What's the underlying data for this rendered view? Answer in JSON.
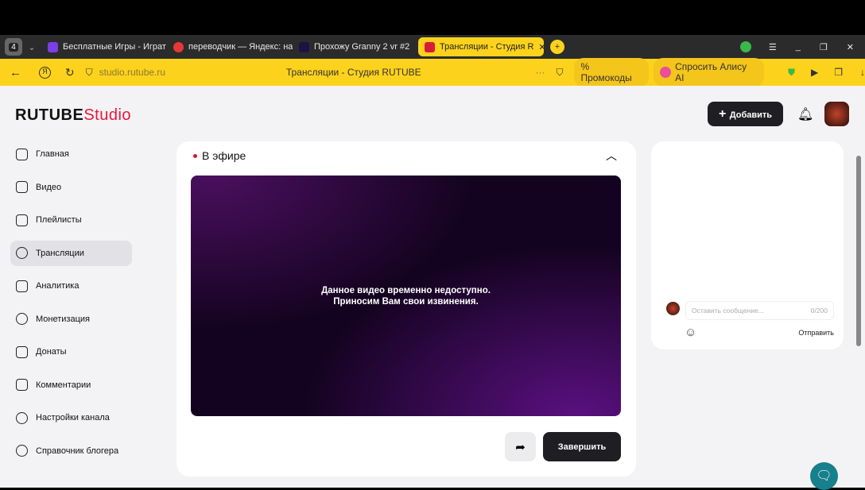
{
  "browser": {
    "tab_count": "4",
    "tabs": [
      {
        "label": "Бесплатные Игры - Играт",
        "color": "#7b3fe4"
      },
      {
        "label": "переводчик — Яндекс: на",
        "color": "#e53935"
      },
      {
        "label": "Прохожу Granny 2 vr #2",
        "color": "#1a1446"
      },
      {
        "label": "Трансляции - Студия R",
        "color": "#d81b3a"
      }
    ],
    "url": "studio.rutube.ru",
    "page_title": "Трансляции - Студия RUTUBE",
    "promo": "Промокоды",
    "alice": "Спросить Алису AI"
  },
  "header": {
    "logo": "RUTUBE",
    "logo_suffix": "Studio",
    "add_label": "Добавить"
  },
  "nav": [
    "Главная",
    "Видео",
    "Плейлисты",
    "Трансляции",
    "Аналитика",
    "Монетизация",
    "Донаты",
    "Комментарии",
    "Настройки канала",
    "Справочник блогера"
  ],
  "stream": {
    "status": "В эфире",
    "message_line1": "Данное видео временно недоступно.",
    "message_line2": "Приносим Вам свои извинения.",
    "finish_label": "Завершить"
  },
  "chat": {
    "placeholder": "Оставить сообщение...",
    "counter": "0/200",
    "send_label": "Отправить"
  }
}
